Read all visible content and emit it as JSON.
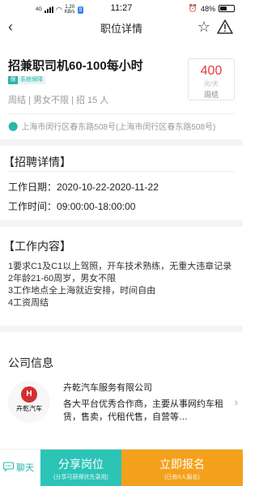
{
  "status_bar": {
    "network": "4G",
    "speed": "1.20",
    "speed_unit": "KB/s",
    "badge": "5",
    "time": "11:27",
    "battery": "48%",
    "battery_level": 0.48
  },
  "header": {
    "title": "职位详情"
  },
  "job": {
    "title": "招兼职司机60-100每小时",
    "verify_label": "系统保障",
    "tags": "周结 | 男女不限 | 招 15 人",
    "salary_amount": "400",
    "salary_unit": "元/天",
    "pay_cycle": "周结",
    "address": "上海市闵行区春东路508号(上海市闵行区春东路508号)"
  },
  "recruit": {
    "heading": "【招聘详情】",
    "date_label": "工作日期：",
    "date_value": "2020-10-22-2020-11-22",
    "time_label": "工作时间：",
    "time_value": "09:00:00-18:00:00"
  },
  "content": {
    "heading": "【工作内容】",
    "lines": [
      "1要求C1及C1以上驾照，开车技术熟练，无重大违章记录",
      "2年龄21-60周岁，男女不限",
      "3工作地点全上海就近安排，时间自由",
      "4工资周结"
    ]
  },
  "company": {
    "heading": "公司信息",
    "logo_text": "卉乾汽车",
    "name": "卉乾汽车服务有限公司",
    "description": "各大平台优秀合作商，主要从事网约车租赁，售卖，代租代售，自营等…"
  },
  "bottom_bar": {
    "chat_label": "聊天",
    "share_label": "分享岗位",
    "share_sub": "(分享可获得优先录用)",
    "apply_label": "立即报名",
    "apply_sub": "(已有0人报名)"
  },
  "colors": {
    "accent": "#2bb5a7",
    "salary": "#e53935",
    "share_button": "#2bc4b6",
    "apply_button": "#f3a11c"
  }
}
